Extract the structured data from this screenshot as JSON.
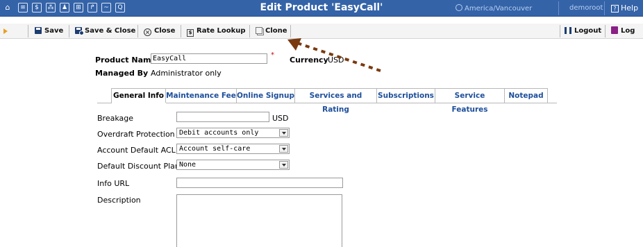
{
  "header": {
    "title": "Edit Product 'EasyCall'",
    "timezone": "America/Vancouver",
    "user": "demoroot",
    "help_label": "Help",
    "icons": [
      "home-icon",
      "list-icon",
      "dollar-icon",
      "network-icon",
      "person-icon",
      "table-icon",
      "transfer-icon",
      "chart-icon",
      "search-icon"
    ]
  },
  "toolbar": {
    "save": "Save",
    "save_close": "Save & Close",
    "close": "Close",
    "rate_lookup": "Rate Lookup",
    "clone": "Clone",
    "logout": "Logout",
    "log": "Log"
  },
  "product": {
    "name_label": "Product Name",
    "name_value": "EasyCall",
    "required_mark": "*",
    "currency_label": "Currency",
    "currency_value": "USD",
    "managed_by_label": "Managed By",
    "managed_by_value": "Administrator only"
  },
  "tabs": [
    {
      "label": "General Info",
      "active": true
    },
    {
      "label": "Maintenance Fee",
      "active": false
    },
    {
      "label": "Online Signup",
      "active": false
    },
    {
      "label": "Services and Rating",
      "active": false
    },
    {
      "label": "Subscriptions",
      "active": false
    },
    {
      "label": "Service Features",
      "active": false
    },
    {
      "label": "Notepad",
      "active": false
    }
  ],
  "form": {
    "breakage_label": "Breakage",
    "breakage_value": "",
    "breakage_unit": "USD",
    "overdraft_label": "Overdraft Protection",
    "overdraft_value": "Debit accounts only",
    "acl_label": "Account Default ACL",
    "acl_value": "Account self-care",
    "discount_label": "Default Discount Plan",
    "discount_value": "None",
    "info_url_label": "Info URL",
    "info_url_value": "",
    "description_label": "Description",
    "description_value": ""
  },
  "colors": {
    "topbar": "#3463a8",
    "tab_link": "#1d4e9a",
    "annotation_arrow": "#7a3a10"
  }
}
